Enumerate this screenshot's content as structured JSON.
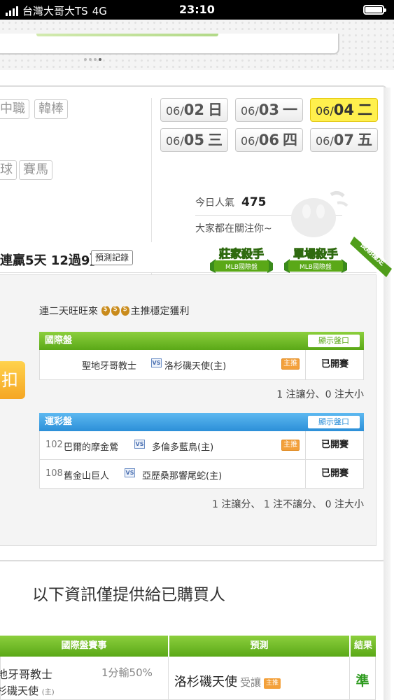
{
  "status_bar": {
    "carrier": "台灣大哥大TS",
    "network": "4G",
    "time": "23:10"
  },
  "leagues": [
    "中職",
    "韓棒",
    "球",
    "賽馬"
  ],
  "dates": [
    {
      "prefix": "06/",
      "day": "02",
      "weekday": "日",
      "active": false
    },
    {
      "prefix": "06/",
      "day": "03",
      "weekday": "一",
      "active": false
    },
    {
      "prefix": "06/",
      "day": "04",
      "weekday": "二",
      "active": true
    },
    {
      "prefix": "06/",
      "day": "05",
      "weekday": "三",
      "active": false
    },
    {
      "prefix": "06/",
      "day": "06",
      "weekday": "四",
      "active": false
    },
    {
      "prefix": "06/",
      "day": "07",
      "weekday": "五",
      "active": false
    }
  ],
  "popularity": {
    "label": "今日人氣",
    "value": "475",
    "note": "大家都在關注你~"
  },
  "badges": [
    {
      "title": "莊家殺手",
      "sub": "MLB國際盤"
    },
    {
      "title": "單場殺手",
      "sub": "MLB國際盤"
    },
    {
      "ribbon": "長期穩定"
    }
  ],
  "record": {
    "title": "連贏5天 12過9】",
    "button": "預測記錄"
  },
  "orange_button_label": "扣",
  "intro": {
    "prefix": "連二天旺旺來",
    "suffix": "主推穩定獲利"
  },
  "intl_section": {
    "title": "國際盤",
    "show_button": "顯示盤口",
    "rows": [
      {
        "num": "",
        "away": "聖地牙哥教士",
        "home": "洛杉磯天使(主)",
        "vs": "VS",
        "main_pick": true,
        "main_label": "主推",
        "status": "已開賽"
      }
    ],
    "summary": "1 注讓分、0 注大小"
  },
  "lottery_section": {
    "title": "運彩盤",
    "show_button": "顯示盤口",
    "rows": [
      {
        "num": "102",
        "away": "巴爾的摩金鶯",
        "home": "多倫多藍鳥(主)",
        "vs": "VS",
        "main_pick": true,
        "main_label": "主推",
        "status": "已開賽"
      },
      {
        "num": "108",
        "away": "舊金山巨人",
        "home": "亞歷桑那響尾蛇(主)",
        "vs": "VS",
        "main_pick": false,
        "main_label": "",
        "status": "已開賽"
      }
    ],
    "summary": "1 注讓分、 1 注不讓分、 0 注大小"
  },
  "info_note": "以下資訊僅提供給已購買人",
  "result_table": {
    "headers": {
      "match": "國際盤賽事",
      "prediction": "預測",
      "result": "結果"
    },
    "row": {
      "team1": "地牙哥教士",
      "team2": "杉磯天使",
      "team2_tag": "(主)",
      "line": "1分輸50%",
      "pick": "洛杉磯天使",
      "pick_type": "受讓",
      "pick_tag": "主推",
      "result": "準"
    }
  },
  "colors": {
    "green": "#5aa817",
    "blue": "#2c8fd8",
    "active_date": "#fff04d",
    "main_pick": "#f3a03a",
    "result_win": "#2e9b1f"
  }
}
